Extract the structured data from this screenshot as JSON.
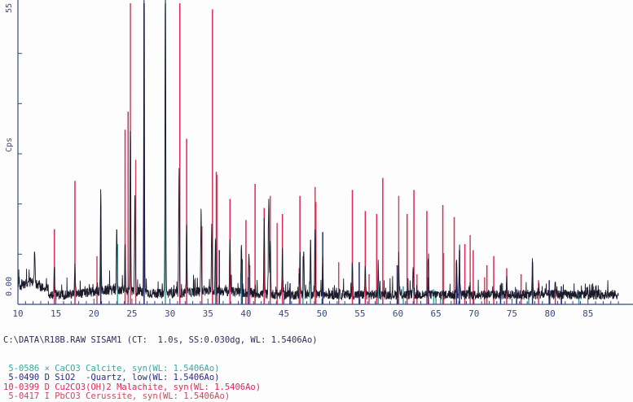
{
  "chart_data": {
    "type": "line",
    "title": "",
    "xlabel": "",
    "ylabel": "Cps",
    "xlim": [
      10,
      89
    ],
    "ylim": [
      0,
      100
    ],
    "x_ticks": [
      10,
      15,
      20,
      25,
      30,
      35,
      40,
      45,
      50,
      55,
      60,
      65,
      70,
      75,
      80,
      85
    ],
    "y_tick_labels": [
      "0.00",
      "55"
    ],
    "grid": false,
    "colors": {
      "background": "#fdfdfd",
      "axis": "#3a4a7a",
      "trace": "#1a1a2a",
      "calcite": "#3aa8a0",
      "quartz": "#2a2a80",
      "malachite": "#e02858",
      "cerussite": "#c84a60"
    },
    "scan_info": "C:\\DATA\\R18B.RAW SISAM1 (CT:  1.0s, SS:0.030dg, WL: 1.5406Ao)",
    "legend": [
      {
        "code": " 5-0586",
        "marker": "×",
        "label": "CaCO3 Calcite, syn(WL: 1.5406Ao)",
        "color": "#3aa8a0"
      },
      {
        "code": " 5-0490",
        "marker": "D",
        "label": "SiO2  -Quartz, low(WL: 1.5406Ao)",
        "color": "#2a2a80"
      },
      {
        "code": "10-0399",
        "marker": "D",
        "label": "Cu2CO3(OH)2 Malachite, syn(WL: 1.5406Ao)",
        "color": "#e02858"
      },
      {
        "code": " 5-0417",
        "marker": "I",
        "label": "PbCO3 Cerussite, syn(WL: 1.5406Ao)",
        "color": "#c84a60"
      }
    ],
    "series": [
      {
        "name": "CaCO3 Calcite, syn",
        "color": "#3aa8a0",
        "peaks": [
          [
            23.1,
            20
          ],
          [
            29.4,
            100
          ],
          [
            36.0,
            22
          ],
          [
            39.4,
            18
          ],
          [
            43.2,
            20
          ],
          [
            47.5,
            16
          ],
          [
            48.5,
            17
          ],
          [
            57.4,
            8
          ],
          [
            60.7,
            6
          ],
          [
            64.7,
            5
          ],
          [
            65.6,
            4
          ],
          [
            77.2,
            3
          ],
          [
            81.5,
            3
          ],
          [
            83.8,
            3
          ]
        ]
      },
      {
        "name": "SiO2  -Quartz, low",
        "color": "#2a2a80",
        "peaks": [
          [
            20.9,
            33
          ],
          [
            26.6,
            100
          ],
          [
            36.5,
            18
          ],
          [
            39.5,
            15
          ],
          [
            40.3,
            9
          ],
          [
            42.4,
            16
          ],
          [
            45.8,
            7
          ],
          [
            50.1,
            24
          ],
          [
            54.9,
            14
          ],
          [
            59.9,
            13
          ],
          [
            64.0,
            9
          ],
          [
            67.7,
            14
          ],
          [
            68.1,
            18
          ],
          [
            73.5,
            6
          ],
          [
            75.6,
            5
          ],
          [
            77.7,
            14
          ],
          [
            79.9,
            8
          ],
          [
            81.5,
            6
          ]
        ]
      },
      {
        "name": "Cu2CO3(OH)2 Malachite, syn",
        "color": "#e02858",
        "peaks": [
          [
            14.8,
            25
          ],
          [
            17.5,
            41
          ],
          [
            24.1,
            58
          ],
          [
            24.5,
            64
          ],
          [
            31.3,
            100
          ],
          [
            32.2,
            55
          ],
          [
            35.6,
            98
          ],
          [
            36.1,
            44
          ],
          [
            37.9,
            35
          ],
          [
            40.0,
            28
          ],
          [
            41.2,
            40
          ],
          [
            42.4,
            32
          ],
          [
            44.8,
            30
          ],
          [
            47.1,
            36
          ],
          [
            49.2,
            34
          ],
          [
            54.0,
            38
          ],
          [
            55.7,
            31
          ],
          [
            57.2,
            30
          ],
          [
            58.0,
            42
          ],
          [
            61.2,
            30
          ],
          [
            62.1,
            38
          ],
          [
            63.8,
            31
          ],
          [
            65.9,
            33
          ],
          [
            67.4,
            29
          ],
          [
            68.8,
            20
          ],
          [
            69.9,
            18
          ],
          [
            71.7,
            13
          ],
          [
            72.6,
            16
          ],
          [
            74.3,
            12
          ],
          [
            76.2,
            10
          ],
          [
            78.5,
            8
          ],
          [
            80.7,
            7
          ]
        ]
      },
      {
        "name": "PbCO3 Cerussite, syn",
        "color": "#c84a60",
        "peaks": [
          [
            20.4,
            16
          ],
          [
            24.8,
            100
          ],
          [
            25.5,
            48
          ],
          [
            34.2,
            26
          ],
          [
            36.2,
            43
          ],
          [
            40.5,
            13
          ],
          [
            43.2,
            36
          ],
          [
            44.1,
            27
          ],
          [
            47.0,
            12
          ],
          [
            49.1,
            39
          ],
          [
            52.2,
            14
          ],
          [
            56.2,
            10
          ],
          [
            60.1,
            36
          ],
          [
            62.5,
            10
          ],
          [
            66.0,
            17
          ],
          [
            69.5,
            23
          ],
          [
            71.4,
            9
          ]
        ]
      }
    ],
    "trace_peaks": [
      [
        12.2,
        12
      ],
      [
        14.8,
        10
      ],
      [
        17.5,
        9
      ],
      [
        20.9,
        33
      ],
      [
        23.0,
        20
      ],
      [
        24.1,
        16
      ],
      [
        24.8,
        52
      ],
      [
        25.4,
        34
      ],
      [
        26.6,
        100
      ],
      [
        29.4,
        100
      ],
      [
        31.2,
        40
      ],
      [
        32.2,
        22
      ],
      [
        34.1,
        28
      ],
      [
        35.5,
        22
      ],
      [
        36.0,
        18
      ],
      [
        37.9,
        18
      ],
      [
        39.4,
        16
      ],
      [
        40.4,
        13
      ],
      [
        42.4,
        24
      ],
      [
        43.0,
        32
      ],
      [
        43.2,
        18
      ],
      [
        44.8,
        14
      ],
      [
        47.1,
        12
      ],
      [
        47.6,
        16
      ],
      [
        48.5,
        18
      ],
      [
        49.1,
        22
      ],
      [
        50.1,
        12
      ],
      [
        54.0,
        10
      ],
      [
        55.7,
        9
      ],
      [
        57.4,
        8
      ],
      [
        60.1,
        10
      ],
      [
        62.0,
        8
      ],
      [
        64.0,
        10
      ],
      [
        67.7,
        12
      ],
      [
        68.1,
        14
      ],
      [
        74.3,
        5
      ],
      [
        77.7,
        12
      ],
      [
        80.7,
        5
      ]
    ]
  }
}
